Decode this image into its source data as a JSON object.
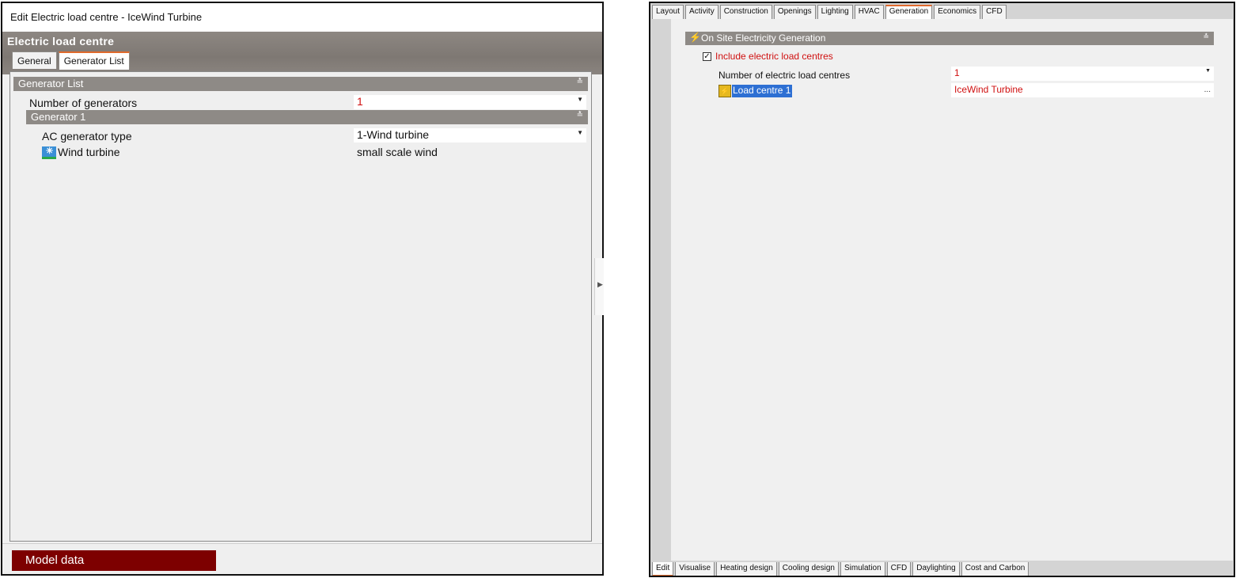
{
  "left_window": {
    "title": "Edit Electric load centre - IceWind Turbine",
    "panel_title": "Electric load centre",
    "tabs": [
      {
        "label": "General",
        "active": false
      },
      {
        "label": "Generator List",
        "active": true
      }
    ],
    "generator_list_header": "Generator List",
    "number_of_generators_label": "Number of generators",
    "number_of_generators_value": "1",
    "generator1_header": "Generator 1",
    "ac_generator_type_label": "AC generator type",
    "ac_generator_type_value": "1-Wind turbine",
    "wind_turbine_label": "Wind turbine",
    "wind_turbine_value": "small scale wind",
    "model_data_button": "Model data"
  },
  "right_window": {
    "top_tabs": [
      {
        "label": "Layout",
        "active": false
      },
      {
        "label": "Activity",
        "active": false
      },
      {
        "label": "Construction",
        "active": false
      },
      {
        "label": "Openings",
        "active": false
      },
      {
        "label": "Lighting",
        "active": false
      },
      {
        "label": "HVAC",
        "active": false
      },
      {
        "label": "Generation",
        "active": true
      },
      {
        "label": "Economics",
        "active": false
      },
      {
        "label": "CFD",
        "active": false
      }
    ],
    "section_header": "On Site Electricity Generation",
    "include_checkbox_label": "Include electric load centres",
    "include_checked": true,
    "num_load_centres_label": "Number of electric load centres",
    "num_load_centres_value": "1",
    "load_centre_label": "Load centre 1",
    "load_centre_value": "IceWind Turbine",
    "bottom_tabs": [
      {
        "label": "Edit",
        "active": true
      },
      {
        "label": "Visualise",
        "active": false
      },
      {
        "label": "Heating design",
        "active": false
      },
      {
        "label": "Cooling design",
        "active": false
      },
      {
        "label": "Simulation",
        "active": false
      },
      {
        "label": "CFD",
        "active": false
      },
      {
        "label": "Daylighting",
        "active": false
      },
      {
        "label": "Cost and Carbon",
        "active": false
      }
    ]
  },
  "colors": {
    "section_gray": "#8e8a86",
    "model_data_red": "#7d0000",
    "value_red": "#d01010",
    "active_tab_orange": "#e06a2c",
    "selection_blue": "#2d6fd3"
  },
  "icons": {
    "wind_turbine": "wind-turbine-icon",
    "lightning": "lightning-icon",
    "load_centre": "load-centre-icon"
  }
}
